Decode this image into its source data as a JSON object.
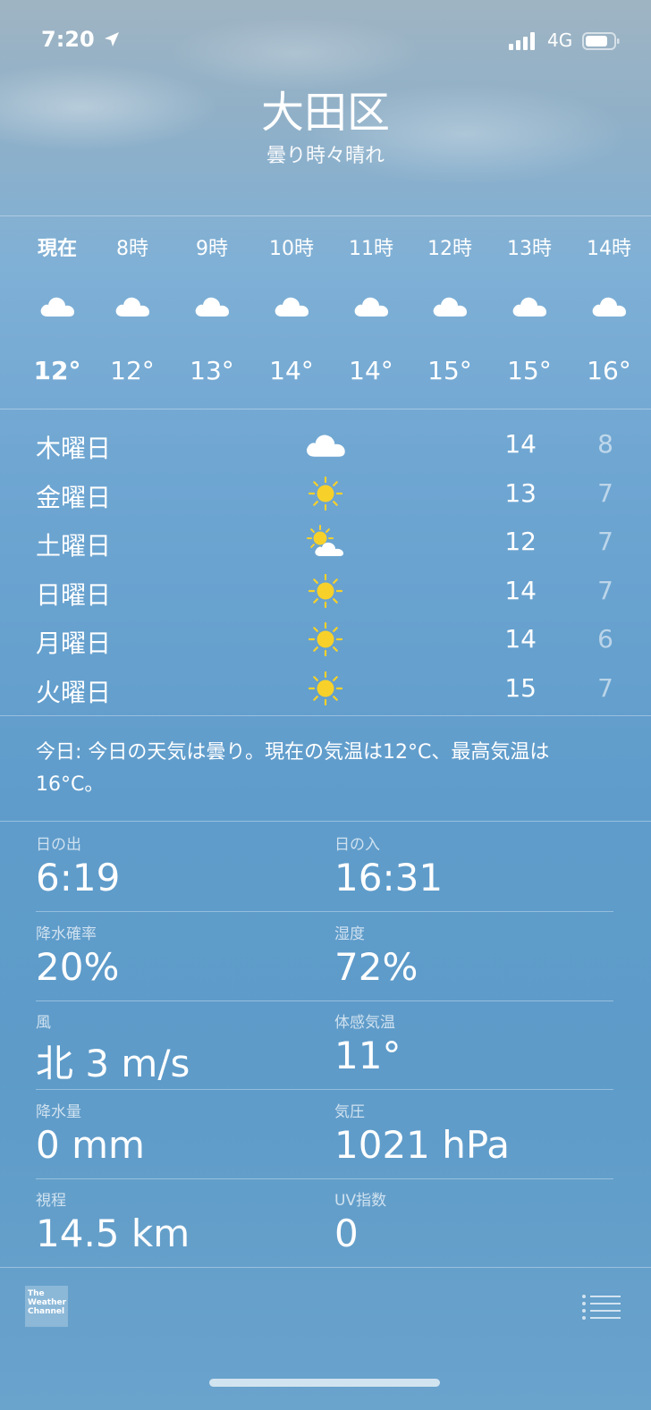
{
  "status_bar": {
    "time": "7:20",
    "network": "4G"
  },
  "location": {
    "city": "大田区",
    "condition": "曇り時々晴れ"
  },
  "hourly": [
    {
      "label": "現在",
      "icon": "cloud-icon",
      "temp": "12°"
    },
    {
      "label": "8時",
      "icon": "cloud-icon",
      "temp": "12°"
    },
    {
      "label": "9時",
      "icon": "cloud-icon",
      "temp": "13°"
    },
    {
      "label": "10時",
      "icon": "cloud-icon",
      "temp": "14°"
    },
    {
      "label": "11時",
      "icon": "cloud-icon",
      "temp": "14°"
    },
    {
      "label": "12時",
      "icon": "cloud-icon",
      "temp": "15°"
    },
    {
      "label": "13時",
      "icon": "cloud-icon",
      "temp": "15°"
    },
    {
      "label": "14時",
      "icon": "cloud-icon",
      "temp": "16°"
    }
  ],
  "daily": [
    {
      "day": "木曜日",
      "icon": "cloud-icon",
      "high": "14",
      "low": "8"
    },
    {
      "day": "金曜日",
      "icon": "sun-icon",
      "high": "13",
      "low": "7"
    },
    {
      "day": "土曜日",
      "icon": "partly-sunny-icon",
      "high": "12",
      "low": "7"
    },
    {
      "day": "日曜日",
      "icon": "sun-icon",
      "high": "14",
      "low": "7"
    },
    {
      "day": "月曜日",
      "icon": "sun-icon",
      "high": "14",
      "low": "6"
    },
    {
      "day": "火曜日",
      "icon": "sun-icon",
      "high": "15",
      "low": "7"
    }
  ],
  "summary": "今日: 今日の天気は曇り。現在の気温は12°C、最高気温は16°C。",
  "details": [
    {
      "label": "日の出",
      "value": "6:19"
    },
    {
      "label": "日の入",
      "value": "16:31"
    },
    {
      "label": "降水確率",
      "value": "20%"
    },
    {
      "label": "湿度",
      "value": "72%"
    },
    {
      "label": "風",
      "value": "北 3 m/s"
    },
    {
      "label": "体感気温",
      "value": "11°"
    },
    {
      "label": "降水量",
      "value": "0 mm"
    },
    {
      "label": "気圧",
      "value": "1021 hPa"
    },
    {
      "label": "視程",
      "value": "14.5 km"
    },
    {
      "label": "UV指数",
      "value": "0"
    }
  ],
  "footer": {
    "logo_text": "The Weather Channel"
  },
  "colors": {
    "sun": "#f7d12a",
    "cloud": "#ffffff",
    "low_temp": "rgba(255,255,255,0.55)"
  }
}
